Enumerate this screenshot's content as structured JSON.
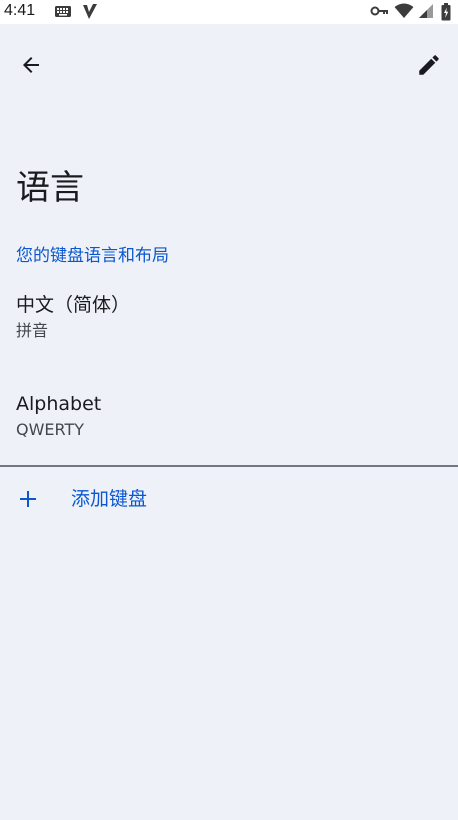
{
  "status_bar": {
    "time": "4:41",
    "icons": [
      "keyboard-icon",
      "v-notification-icon",
      "vpn-key-icon",
      "wifi-icon",
      "signal-icon",
      "battery-icon"
    ]
  },
  "app_bar": {
    "back_icon": "arrow-back-icon",
    "edit_icon": "pencil-icon"
  },
  "page": {
    "title": "语言",
    "section_header": "您的键盘语言和布局"
  },
  "keyboards": [
    {
      "name": "中文（简体）",
      "layout": "拼音"
    },
    {
      "name": "Alphabet",
      "layout": "QWERTY"
    }
  ],
  "add_keyboard": {
    "icon": "plus-icon",
    "label": "添加键盘"
  },
  "colors": {
    "background": "#eef2f8",
    "accent": "#0b57d0",
    "text_primary": "#1b1b1f",
    "text_secondary": "#44474e",
    "divider": "#74777f"
  }
}
